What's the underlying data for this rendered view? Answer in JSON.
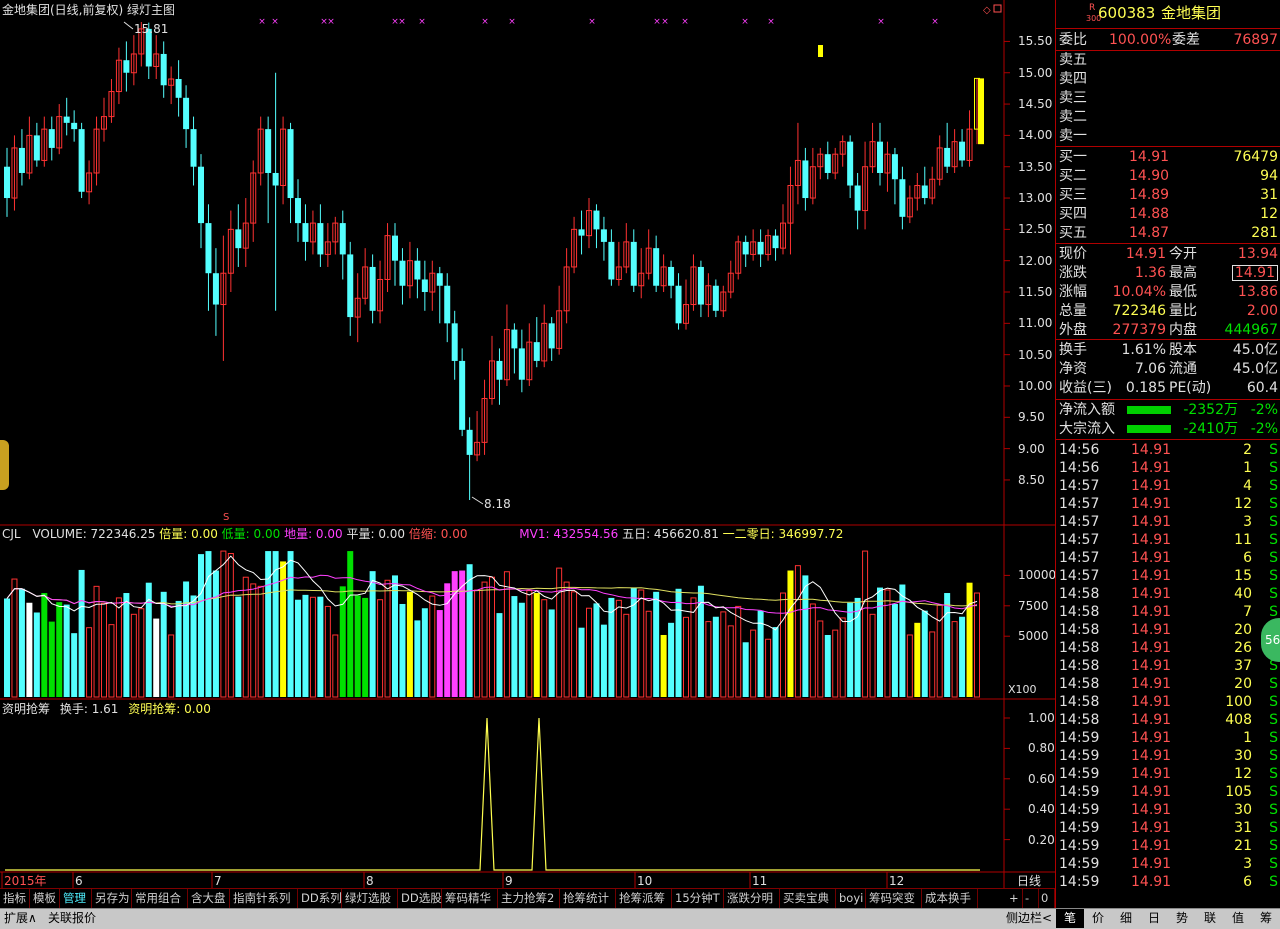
{
  "chart": {
    "title": "金地集团(日线,前复权) 绿灯主图",
    "high_label": "15.81",
    "low_label": "8.18",
    "price_ticks": [
      "15.50",
      "15.00",
      "14.50",
      "14.00",
      "13.50",
      "13.00",
      "12.50",
      "12.00",
      "11.50",
      "11.00",
      "10.50",
      "10.00",
      "9.50",
      "9.00",
      "8.50"
    ],
    "vol_ticks": [
      "10000",
      "7500",
      "5000"
    ],
    "vol_unit": "X100",
    "ind_ticks": [
      "1.00",
      "0.80",
      "0.60",
      "0.40",
      "0.20"
    ],
    "months": [
      "2015年",
      "6",
      "7",
      "8",
      "9",
      "10",
      "11",
      "12"
    ],
    "period": "日线",
    "s_mark": "S"
  },
  "volume_legend": {
    "name": "CJL",
    "volume": "VOLUME: 722346.25",
    "beiliang": "倍量: 0.00",
    "diliang_low": "低量: 0.00",
    "diliang": "地量: 0.00",
    "pingliang": "平量: 0.00",
    "beisuo": "倍缩: 0.00",
    "mv1": "MV1: 432554.56",
    "wuri": "五日: 456620.81",
    "yierling": "一二零日: 346997.72"
  },
  "indicator_legend": {
    "name": "资明抢筹",
    "huanshou": "换手: 1.61",
    "qiangchou": "资明抢筹: 0.00"
  },
  "quote": {
    "code_prefix": "R",
    "code_sub": "300",
    "code": "600383",
    "name": "金地集团",
    "weibi_label": "委比",
    "weibi": "100.00%",
    "weicha_label": "委差",
    "weicha": "76897",
    "asks": [
      "卖五",
      "卖四",
      "卖三",
      "卖二",
      "卖一"
    ],
    "bids": [
      {
        "label": "买一",
        "price": "14.91",
        "vol": "76479"
      },
      {
        "label": "买二",
        "price": "14.90",
        "vol": "94"
      },
      {
        "label": "买三",
        "price": "14.89",
        "vol": "31"
      },
      {
        "label": "买四",
        "price": "14.88",
        "vol": "12"
      },
      {
        "label": "买五",
        "price": "14.87",
        "vol": "281"
      }
    ],
    "stats": [
      {
        "l1": "现价",
        "v1": "14.91",
        "c1": "r",
        "l2": "今开",
        "v2": "13.94",
        "c2": "r"
      },
      {
        "l1": "涨跌",
        "v1": "1.36",
        "c1": "r",
        "l2": "最高",
        "v2": "14.91",
        "c2": "r"
      },
      {
        "l1": "涨幅",
        "v1": "10.04%",
        "c1": "r",
        "l2": "最低",
        "v2": "13.86",
        "c2": "r"
      },
      {
        "l1": "总量",
        "v1": "722346",
        "c1": "y",
        "l2": "量比",
        "v2": "2.00",
        "c2": "r"
      },
      {
        "l1": "外盘",
        "v1": "277379",
        "c1": "r",
        "l2": "内盘",
        "v2": "444967",
        "c2": "g"
      }
    ],
    "stats2": [
      {
        "l1": "换手",
        "v1": "1.61%",
        "l2": "股本",
        "v2": "45.0亿"
      },
      {
        "l1": "净资",
        "v1": "7.06",
        "l2": "流通",
        "v2": "45.0亿"
      },
      {
        "l1": "收益(三)",
        "v1": "0.185",
        "l2": "PE(动)",
        "v2": "60.4"
      }
    ],
    "flows": [
      {
        "label": "净流入额",
        "value": "-2352万",
        "pct": "-2%"
      },
      {
        "label": "大宗流入",
        "value": "-2410万",
        "pct": "-2%"
      }
    ],
    "ticks": [
      {
        "t": "14:56",
        "p": "14.91",
        "v": "2",
        "s": "S"
      },
      {
        "t": "14:56",
        "p": "14.91",
        "v": "1",
        "s": "S"
      },
      {
        "t": "14:57",
        "p": "14.91",
        "v": "4",
        "s": "S"
      },
      {
        "t": "14:57",
        "p": "14.91",
        "v": "12",
        "s": "S"
      },
      {
        "t": "14:57",
        "p": "14.91",
        "v": "3",
        "s": "S"
      },
      {
        "t": "14:57",
        "p": "14.91",
        "v": "11",
        "s": "S"
      },
      {
        "t": "14:57",
        "p": "14.91",
        "v": "6",
        "s": "S"
      },
      {
        "t": "14:57",
        "p": "14.91",
        "v": "15",
        "s": "S"
      },
      {
        "t": "14:58",
        "p": "14.91",
        "v": "40",
        "s": "S"
      },
      {
        "t": "14:58",
        "p": "14.91",
        "v": "7",
        "s": "S"
      },
      {
        "t": "14:58",
        "p": "14.91",
        "v": "20",
        "s": "S"
      },
      {
        "t": "14:58",
        "p": "14.91",
        "v": "26",
        "s": "S"
      },
      {
        "t": "14:58",
        "p": "14.91",
        "v": "37",
        "s": "S"
      },
      {
        "t": "14:58",
        "p": "14.91",
        "v": "20",
        "s": "S"
      },
      {
        "t": "14:58",
        "p": "14.91",
        "v": "100",
        "s": "S"
      },
      {
        "t": "14:58",
        "p": "14.91",
        "v": "408",
        "s": "S"
      },
      {
        "t": "14:59",
        "p": "14.91",
        "v": "1",
        "s": "S"
      },
      {
        "t": "14:59",
        "p": "14.91",
        "v": "30",
        "s": "S"
      },
      {
        "t": "14:59",
        "p": "14.91",
        "v": "12",
        "s": "S"
      },
      {
        "t": "14:59",
        "p": "14.91",
        "v": "105",
        "s": "S"
      },
      {
        "t": "14:59",
        "p": "14.91",
        "v": "30",
        "s": "S"
      },
      {
        "t": "14:59",
        "p": "14.91",
        "v": "31",
        "s": "S"
      },
      {
        "t": "14:59",
        "p": "14.91",
        "v": "21",
        "s": "S"
      },
      {
        "t": "14:59",
        "p": "14.91",
        "v": "3",
        "s": "S"
      },
      {
        "t": "14:59",
        "p": "14.91",
        "v": "6",
        "s": "S"
      }
    ],
    "badge": "56"
  },
  "toolbar": [
    "指标",
    "模板",
    "管理",
    "另存为",
    "常用组合",
    "含大盘",
    "指南针系列",
    "DD系列",
    "绿灯选股",
    "DD选股",
    "筹码精华",
    "主力抢筹2",
    "抢筹统计",
    "抢筹派筹",
    "15分钟T",
    "涨跌分明",
    "买卖宝典",
    "boyi",
    "筹码突变",
    "成本换手"
  ],
  "toolbar_right": [
    "+",
    "-",
    "0"
  ],
  "bottom": {
    "expand": "扩展∧",
    "related": "关联报价",
    "sidebar": "侧边栏<",
    "tabs": [
      "笔",
      "价",
      "细",
      "日",
      "势",
      "联",
      "值",
      "筹"
    ]
  },
  "chart_data": {
    "type": "candlestick",
    "title": "金地集团(日线,前复权) 绿灯主图",
    "price_range": [
      8.0,
      15.81
    ],
    "high": 15.81,
    "low": 8.18,
    "last": 14.91,
    "x_labels": [
      "2015年",
      "6",
      "7",
      "8",
      "9",
      "10",
      "11",
      "12"
    ],
    "candles": [
      [
        13.5,
        13.0,
        13.8,
        12.7
      ],
      [
        13.0,
        13.8,
        14.0,
        12.8
      ],
      [
        13.8,
        13.4,
        14.1,
        13.2
      ],
      [
        13.4,
        14.0,
        14.3,
        13.3
      ],
      [
        14.0,
        13.6,
        14.2,
        13.5
      ],
      [
        13.6,
        14.1,
        14.3,
        13.5
      ],
      [
        14.1,
        13.8,
        14.3,
        13.6
      ],
      [
        13.8,
        14.3,
        14.5,
        13.7
      ],
      [
        14.3,
        14.2,
        14.6,
        14.0
      ],
      [
        14.2,
        14.1,
        14.4,
        13.9
      ],
      [
        14.1,
        13.1,
        14.2,
        13.0
      ],
      [
        13.1,
        13.4,
        13.6,
        12.9
      ],
      [
        13.4,
        14.1,
        14.3,
        13.2
      ],
      [
        14.1,
        14.3,
        14.6,
        13.9
      ],
      [
        14.3,
        14.7,
        14.9,
        14.2
      ],
      [
        14.7,
        15.2,
        15.4,
        14.5
      ],
      [
        15.2,
        15.0,
        15.5,
        14.7
      ],
      [
        15.0,
        15.3,
        15.6,
        14.8
      ],
      [
        15.3,
        15.7,
        15.81,
        15.1
      ],
      [
        15.7,
        15.1,
        15.8,
        14.9
      ],
      [
        15.1,
        15.3,
        15.6,
        14.9
      ],
      [
        15.3,
        14.8,
        15.5,
        14.6
      ],
      [
        14.8,
        14.9,
        15.1,
        14.5
      ],
      [
        14.9,
        14.6,
        15.2,
        14.3
      ],
      [
        14.6,
        14.1,
        14.8,
        13.8
      ],
      [
        14.1,
        13.5,
        14.3,
        13.2
      ],
      [
        13.5,
        12.6,
        13.7,
        12.2
      ],
      [
        12.6,
        11.8,
        12.9,
        11.2
      ],
      [
        11.8,
        11.3,
        12.2,
        10.8
      ],
      [
        11.3,
        11.8,
        12.4,
        10.4
      ],
      [
        11.8,
        12.5,
        12.8,
        11.5
      ],
      [
        12.5,
        12.2,
        12.9,
        11.9
      ],
      [
        12.2,
        12.6,
        13.0,
        11.9
      ],
      [
        12.6,
        13.4,
        13.6,
        12.3
      ],
      [
        13.4,
        14.1,
        14.3,
        13.2
      ],
      [
        14.1,
        13.4,
        14.3,
        12.6
      ],
      [
        13.4,
        13.2,
        15.0,
        11.2
      ],
      [
        13.2,
        14.1,
        14.3,
        12.9
      ],
      [
        14.1,
        13.0,
        14.2,
        12.6
      ],
      [
        13.0,
        12.6,
        13.3,
        12.3
      ],
      [
        12.6,
        12.3,
        12.9,
        12.0
      ],
      [
        12.3,
        12.6,
        12.8,
        12.1
      ],
      [
        12.6,
        12.1,
        12.9,
        11.9
      ],
      [
        12.1,
        12.3,
        12.6,
        11.9
      ],
      [
        12.3,
        12.6,
        12.7,
        12.1
      ],
      [
        12.6,
        12.1,
        12.8,
        11.7
      ],
      [
        12.1,
        11.1,
        12.3,
        10.8
      ],
      [
        11.1,
        11.4,
        11.8,
        10.7
      ],
      [
        11.4,
        11.9,
        12.2,
        11.3
      ],
      [
        11.9,
        11.2,
        12.1,
        11.0
      ],
      [
        11.2,
        11.7,
        12.0,
        11.0
      ],
      [
        11.7,
        12.4,
        12.6,
        11.5
      ],
      [
        12.4,
        12.0,
        12.6,
        11.6
      ],
      [
        12.0,
        11.6,
        12.2,
        11.3
      ],
      [
        11.6,
        12.0,
        12.3,
        11.4
      ],
      [
        12.0,
        11.7,
        12.2,
        11.4
      ],
      [
        11.7,
        11.5,
        12.0,
        11.2
      ],
      [
        11.5,
        11.8,
        12.0,
        11.2
      ],
      [
        11.8,
        11.6,
        11.9,
        11.0
      ],
      [
        11.6,
        11.0,
        11.8,
        10.7
      ],
      [
        11.0,
        10.4,
        11.2,
        10.1
      ],
      [
        10.4,
        9.3,
        10.6,
        9.2
      ],
      [
        9.3,
        8.9,
        9.5,
        8.18
      ],
      [
        8.9,
        9.1,
        9.6,
        8.8
      ],
      [
        9.1,
        9.8,
        10.1,
        8.9
      ],
      [
        9.8,
        10.4,
        10.8,
        9.7
      ],
      [
        10.4,
        10.1,
        10.6,
        9.7
      ],
      [
        10.1,
        10.9,
        11.3,
        10.0
      ],
      [
        10.9,
        10.6,
        11.0,
        10.2
      ],
      [
        10.6,
        10.1,
        10.9,
        9.9
      ],
      [
        10.1,
        10.7,
        11.0,
        10.0
      ],
      [
        10.7,
        10.4,
        11.1,
        10.3
      ],
      [
        10.4,
        11.0,
        11.3,
        10.3
      ],
      [
        11.0,
        10.6,
        11.1,
        10.4
      ],
      [
        10.6,
        11.2,
        11.6,
        10.5
      ],
      [
        11.2,
        11.9,
        12.2,
        11.0
      ],
      [
        11.9,
        12.5,
        12.7,
        11.8
      ],
      [
        12.5,
        12.4,
        12.8,
        12.1
      ],
      [
        12.4,
        12.8,
        13.0,
        12.2
      ],
      [
        12.8,
        12.5,
        12.9,
        12.2
      ],
      [
        12.5,
        12.3,
        12.7,
        12.0
      ],
      [
        12.3,
        11.7,
        12.5,
        11.6
      ],
      [
        11.7,
        11.9,
        12.3,
        11.6
      ],
      [
        11.9,
        12.3,
        12.6,
        11.8
      ],
      [
        12.3,
        11.6,
        12.5,
        11.5
      ],
      [
        11.6,
        11.8,
        12.2,
        11.4
      ],
      [
        11.8,
        12.2,
        12.5,
        11.7
      ],
      [
        12.2,
        11.6,
        12.4,
        11.5
      ],
      [
        11.6,
        11.9,
        12.1,
        11.5
      ],
      [
        11.9,
        11.6,
        12.0,
        11.4
      ],
      [
        11.6,
        11.0,
        11.8,
        10.9
      ],
      [
        11.0,
        11.3,
        11.7,
        10.9
      ],
      [
        11.3,
        11.9,
        12.1,
        11.2
      ],
      [
        11.9,
        11.3,
        12.0,
        11.1
      ],
      [
        11.3,
        11.6,
        11.8,
        11.1
      ],
      [
        11.6,
        11.2,
        11.7,
        11.1
      ],
      [
        11.2,
        11.5,
        11.6,
        11.1
      ],
      [
        11.5,
        11.8,
        12.0,
        11.4
      ],
      [
        11.8,
        12.3,
        12.4,
        11.7
      ],
      [
        12.3,
        12.1,
        12.4,
        11.9
      ],
      [
        12.1,
        12.3,
        12.5,
        12.0
      ],
      [
        12.3,
        12.1,
        12.5,
        11.9
      ],
      [
        12.1,
        12.4,
        12.5,
        12.0
      ],
      [
        12.4,
        12.2,
        12.5,
        12.0
      ],
      [
        12.2,
        12.6,
        12.9,
        12.1
      ],
      [
        12.6,
        13.2,
        13.5,
        12.1
      ],
      [
        13.2,
        13.6,
        14.2,
        12.9
      ],
      [
        13.6,
        13.0,
        13.8,
        12.8
      ],
      [
        13.0,
        13.5,
        13.8,
        12.9
      ],
      [
        13.5,
        13.7,
        13.8,
        13.3
      ],
      [
        13.7,
        13.4,
        13.9,
        13.3
      ],
      [
        13.4,
        13.7,
        13.8,
        13.3
      ],
      [
        13.7,
        13.9,
        14.0,
        13.5
      ],
      [
        13.9,
        13.2,
        14.0,
        13.0
      ],
      [
        13.2,
        12.8,
        13.4,
        12.5
      ],
      [
        12.8,
        13.5,
        13.9,
        12.5
      ],
      [
        13.5,
        13.9,
        14.2,
        13.4
      ],
      [
        13.9,
        13.4,
        14.2,
        13.2
      ],
      [
        13.4,
        13.7,
        13.9,
        13.1
      ],
      [
        13.7,
        13.3,
        13.8,
        12.9
      ],
      [
        13.3,
        12.7,
        13.5,
        12.5
      ],
      [
        12.7,
        13.0,
        13.2,
        12.6
      ],
      [
        13.0,
        13.2,
        13.4,
        12.8
      ],
      [
        13.2,
        13.0,
        13.5,
        12.9
      ],
      [
        13.0,
        13.3,
        13.5,
        12.9
      ],
      [
        13.3,
        13.8,
        14.0,
        13.2
      ],
      [
        13.8,
        13.5,
        14.2,
        13.4
      ],
      [
        13.5,
        13.9,
        14.1,
        13.4
      ],
      [
        13.9,
        13.6,
        14.1,
        13.5
      ],
      [
        13.6,
        14.1,
        14.4,
        13.5
      ],
      [
        14.1,
        14.91,
        14.91,
        13.86
      ]
    ]
  }
}
